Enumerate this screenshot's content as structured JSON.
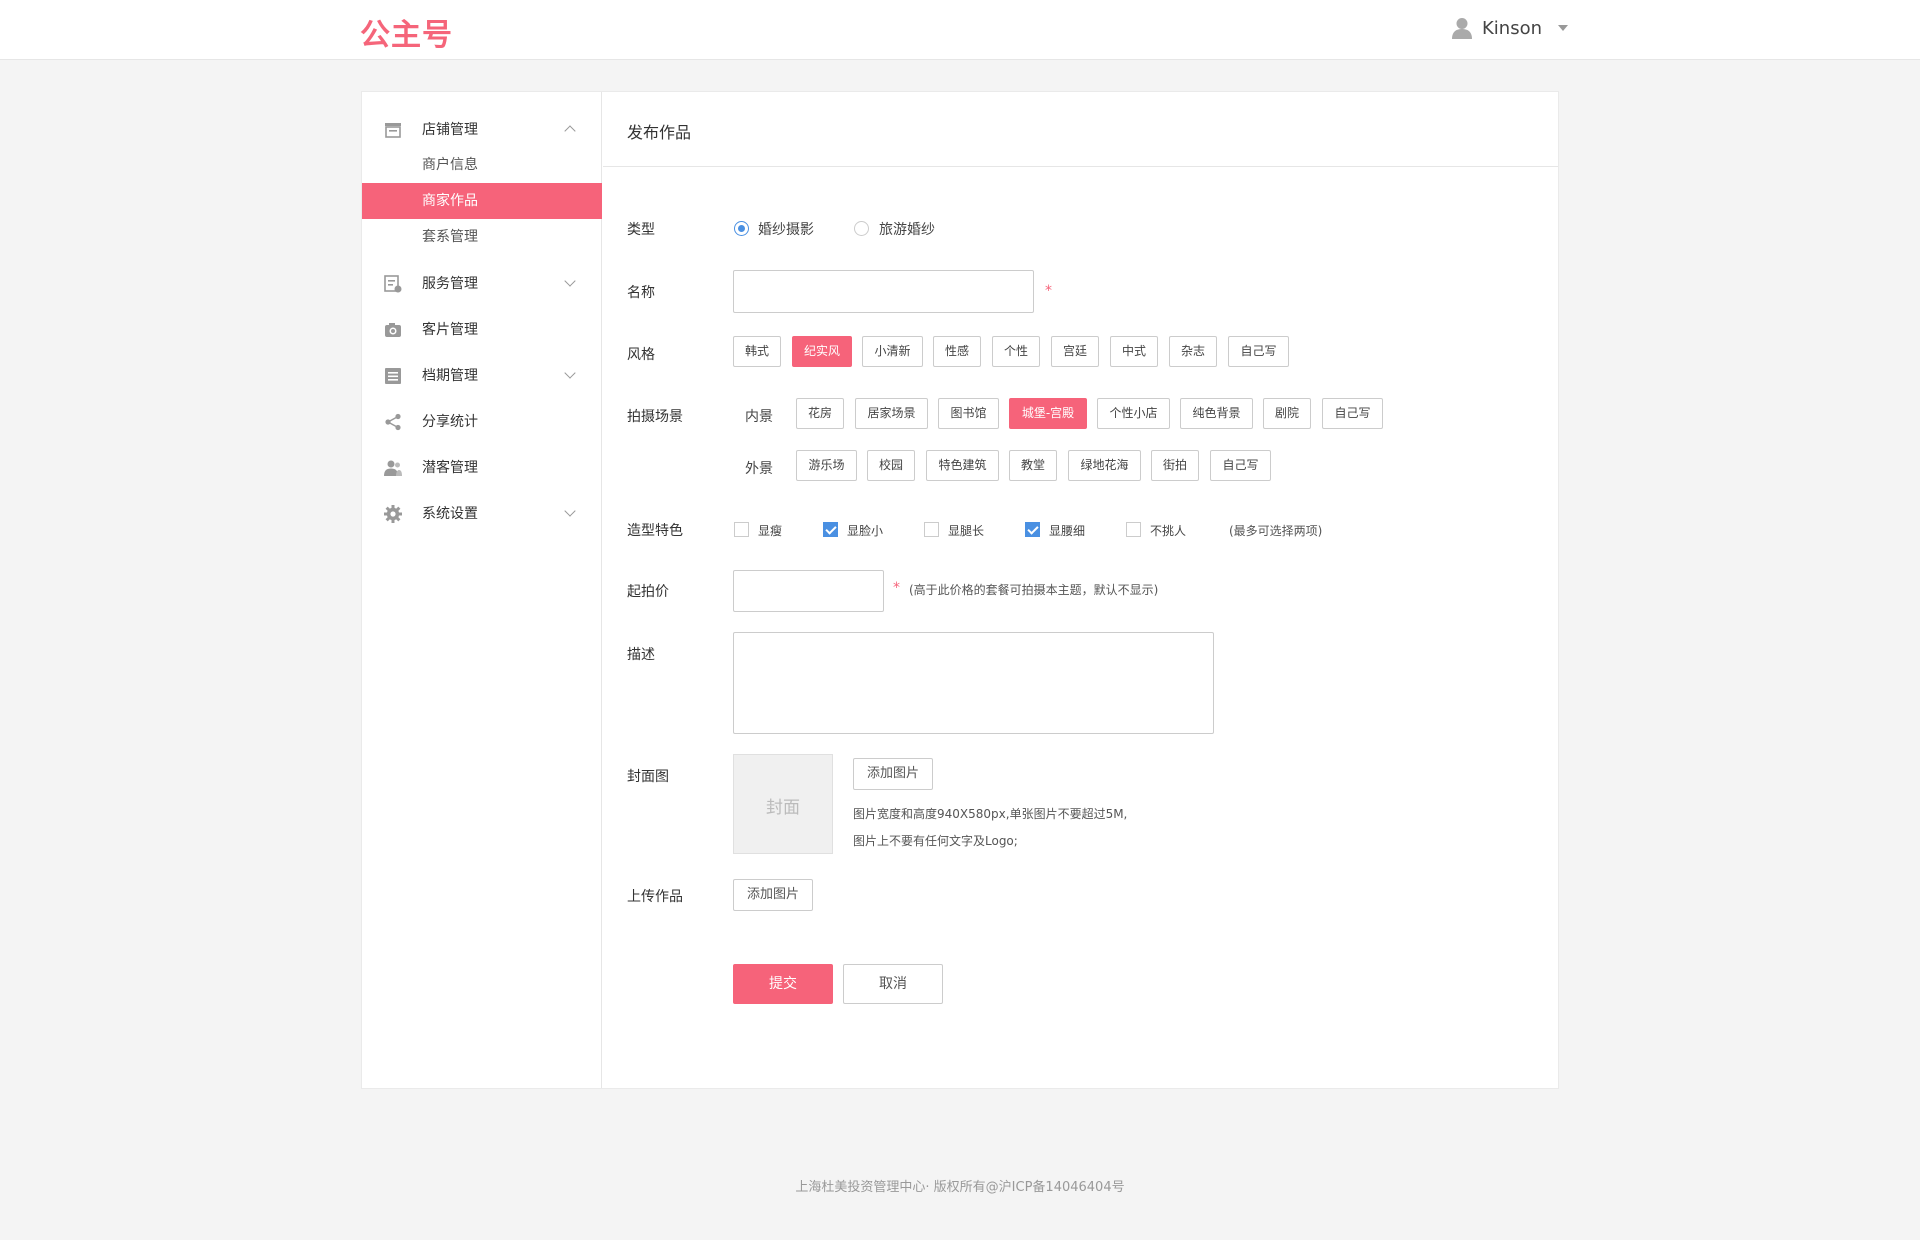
{
  "brand": {
    "logo": "公主号",
    "accent": "#f6637a"
  },
  "header": {
    "user_name": "Kinson"
  },
  "sidebar": {
    "groups": [
      {
        "label": "店铺管理",
        "icon": "store-icon",
        "expanded": true,
        "items": [
          {
            "label": "商户信息"
          },
          {
            "label": "商家作品",
            "active": true
          },
          {
            "label": "套系管理"
          }
        ]
      },
      {
        "label": "服务管理",
        "icon": "service-icon",
        "expanded": false
      },
      {
        "label": "客片管理",
        "icon": "camera-icon",
        "expanded": false
      },
      {
        "label": "档期管理",
        "icon": "schedule-icon",
        "expanded": false
      },
      {
        "label": "分享统计",
        "icon": "share-icon",
        "expanded": false
      },
      {
        "label": "潜客管理",
        "icon": "users-icon",
        "expanded": false
      },
      {
        "label": "系统设置",
        "icon": "gear-icon",
        "expanded": false
      }
    ]
  },
  "main": {
    "title": "发布作品"
  },
  "form": {
    "type": {
      "label": "类型",
      "options": [
        "婚纱摄影",
        "旅游婚纱"
      ],
      "selected": "婚纱摄影"
    },
    "name": {
      "label": "名称",
      "value": "",
      "required_mark": "*"
    },
    "style": {
      "label": "风格",
      "options": [
        "韩式",
        "纪实风",
        "小清新",
        "性感",
        "个性",
        "宫廷",
        "中式",
        "杂志",
        "自己写"
      ],
      "selected": "纪实风"
    },
    "scene": {
      "label": "拍摄场景",
      "indoor": {
        "label": "内景",
        "options": [
          "花房",
          "居家场景",
          "图书馆",
          "城堡-宫殿",
          "个性小店",
          "纯色背景",
          "剧院",
          "自己写"
        ],
        "selected": "城堡-宫殿"
      },
      "outdoor": {
        "label": "外景",
        "options": [
          "游乐场",
          "校园",
          "特色建筑",
          "教堂",
          "绿地花海",
          "街拍",
          "自己写"
        ],
        "selected": ""
      }
    },
    "feature": {
      "label": "造型特色",
      "options": [
        "显瘦",
        "显脸小",
        "显腿长",
        "显腰细",
        "不挑人"
      ],
      "checked": [
        "显脸小",
        "显腰细"
      ],
      "hint": "(最多可选择两项)"
    },
    "price": {
      "label": "起拍价",
      "value": "",
      "required_mark": "*",
      "hint": "(高于此价格的套餐可拍摄本主题，默认不显示)"
    },
    "desc": {
      "label": "描述",
      "value": ""
    },
    "cover": {
      "label": "封面图",
      "placeholder": "封面",
      "add_button": "添加图片",
      "hint_line1": "图片宽度和高度940X580px,单张图片不要超过5M,",
      "hint_line2": "图片上不要有任何文字及Logo;"
    },
    "upload": {
      "label": "上传作品",
      "add_button": "添加图片"
    },
    "submit_label": "提交",
    "cancel_label": "取消"
  },
  "footer": {
    "text": "上海杜美投资管理中心· 版权所有@沪ICP备14046404号"
  }
}
